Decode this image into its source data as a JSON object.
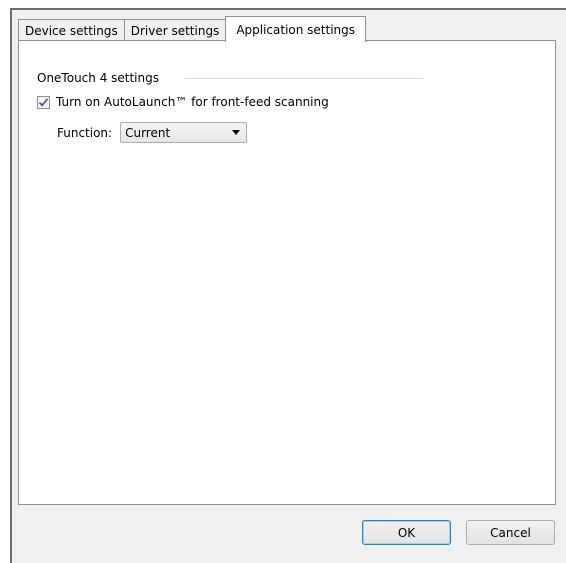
{
  "tabs": [
    {
      "label": "Device settings",
      "active": false
    },
    {
      "label": "Driver settings",
      "active": false
    },
    {
      "label": "Application settings",
      "active": true
    }
  ],
  "group": {
    "title": "OneTouch 4 settings"
  },
  "autolaunch": {
    "label": "Turn on AutoLaunch™ for front-feed scanning",
    "checked": true
  },
  "function": {
    "label": "Function:",
    "selected": "Current"
  },
  "buttons": {
    "ok": "OK",
    "cancel": "Cancel"
  },
  "colors": {
    "panel_bg": "#ffffff",
    "dialog_bg": "#f0f0f0",
    "check_mark": "#4a5f97",
    "default_button_border": "#3c7fb1"
  }
}
